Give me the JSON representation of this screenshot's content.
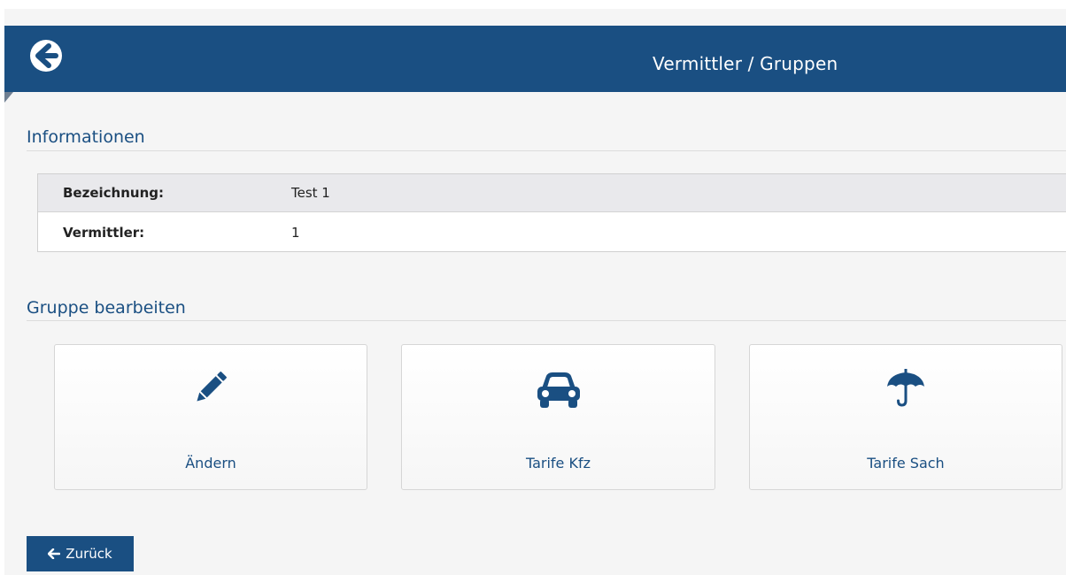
{
  "header": {
    "title": "Vermittler / Gruppen",
    "back_icon": "arrow-circle-left-icon"
  },
  "info_section": {
    "title": "Informationen",
    "rows": [
      {
        "label": "Bezeichnung:",
        "value": "Test 1"
      },
      {
        "label": "Vermittler:",
        "value": "1"
      }
    ]
  },
  "edit_section": {
    "title": "Gruppe bearbeiten",
    "tiles": [
      {
        "label": "Ändern",
        "icon": "pencil-icon"
      },
      {
        "label": "Tarife Kfz",
        "icon": "car-icon"
      },
      {
        "label": "Tarife Sach",
        "icon": "umbrella-icon"
      }
    ]
  },
  "footer": {
    "back_label": "Zurück",
    "back_icon": "arrow-left-icon"
  },
  "colors": {
    "brand": "#1a4f82",
    "page_background": "#f5f5f5"
  }
}
